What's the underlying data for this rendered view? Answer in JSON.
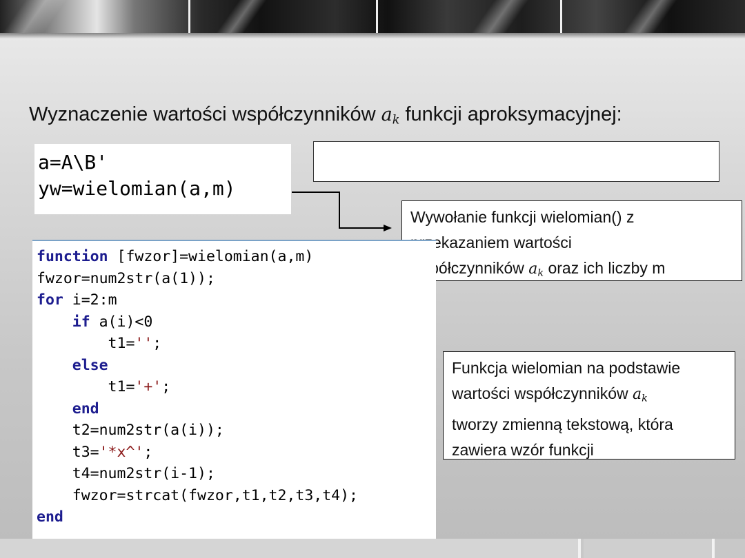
{
  "title": {
    "before": "Wyznaczenie wartości współczynników ",
    "math_base": "a",
    "math_sub": "k",
    "after": " funkcji aproksymacyjnej:"
  },
  "code_small": {
    "lines": [
      "a=A\\B'",
      "yw=wielomian(a,m)"
    ]
  },
  "callout_call": {
    "line1": "Wywołanie funkcji wielomian() z",
    "line2": "przekazaniem wartości",
    "line3_before": "współczynników ",
    "math_base": "a",
    "math_sub": "k",
    "line3_after": " oraz ich liczby m"
  },
  "callout_function": {
    "line1": "Funkcja wielomian na podstawie",
    "line2_before": "wartości współczynników ",
    "math_base": "a",
    "math_sub": "k",
    "line3": "tworzy zmienną tekstową, która",
    "line4": "zawiera wzór funkcji"
  },
  "code_main": {
    "l1_kw": "function",
    "l1_rest": " [fwzor]=wielomian(a,m)",
    "l2": "fwzor=num2str(a(1));",
    "l3_kw": "for",
    "l3_rest": " i=2:m",
    "l4_indent": "    ",
    "l4_kw": "if",
    "l4_rest": " a(i)<0",
    "l5_pre": "        t1=",
    "l5_str": "''",
    "l5_post": ";",
    "l6_indent": "    ",
    "l6_kw": "else",
    "l7_pre": "        t1=",
    "l7_str": "'+'",
    "l7_post": ";",
    "l8_indent": "    ",
    "l8_kw": "end",
    "l9": "    t2=num2str(a(i));",
    "l10_pre": "    t3=",
    "l10_str": "'*x^'",
    "l10_post": ";",
    "l11": "    t4=num2str(i-1);",
    "l12": "    fwzor=strcat(fwzor,t1,t2,t3,t4);",
    "l13_kw": "end"
  }
}
